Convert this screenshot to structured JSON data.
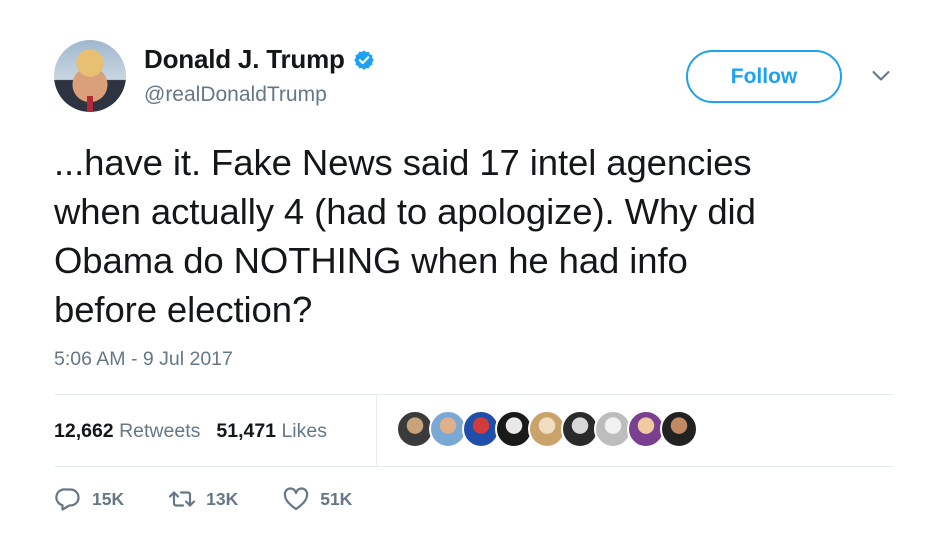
{
  "author": {
    "display_name": "Donald J. Trump",
    "handle": "@realDonaldTrump",
    "verified": true
  },
  "header": {
    "follow_label": "Follow"
  },
  "tweet": {
    "lines": [
      "...have it. Fake News said 17 intel agencies",
      "when actually 4 (had to apologize). Why did",
      "Obama do NOTHING when he had info",
      "before election?"
    ],
    "timestamp": "5:06 AM - 9 Jul 2017"
  },
  "stats": {
    "retweets_count": "12,662",
    "retweets_label": "Retweets",
    "likes_count": "51,471",
    "likes_label": "Likes"
  },
  "liker_avatars": [
    {
      "color_a": "#3b3b3b",
      "color_b": "#c8a27a"
    },
    {
      "color_a": "#7aa9d6",
      "color_b": "#e0b08a"
    },
    {
      "color_a": "#1f4fa8",
      "color_b": "#d23b3b"
    },
    {
      "color_a": "#1a1a1a",
      "color_b": "#e9e9e9"
    },
    {
      "color_a": "#c9a36a",
      "color_b": "#f1ddc0"
    },
    {
      "color_a": "#2a2a2a",
      "color_b": "#d8d8d8"
    },
    {
      "color_a": "#bdbdbd",
      "color_b": "#f2f2f2"
    },
    {
      "color_a": "#7b3f8f",
      "color_b": "#f0c9a0"
    },
    {
      "color_a": "#222222",
      "color_b": "#c08a62"
    }
  ],
  "actions": {
    "reply_count": "15K",
    "retweet_count": "13K",
    "like_count": "51K"
  },
  "colors": {
    "accent": "#1da1f2",
    "secondary_text": "#657786",
    "divider": "#e6ecf0"
  }
}
